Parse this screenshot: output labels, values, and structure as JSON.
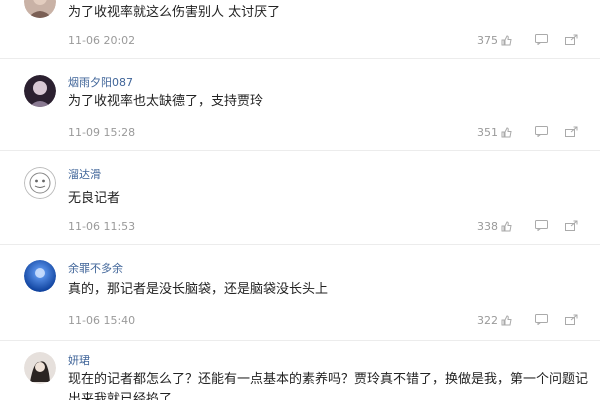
{
  "comments": [
    {
      "username": "",
      "text": "为了收视率就这么伤害别人 太讨厌了",
      "time": "11-06 20:02",
      "likes": "375"
    },
    {
      "username": "烟雨夕阳087",
      "text": "为了收视率也太缺德了，支持贾玲",
      "time": "11-09 15:28",
      "likes": "351"
    },
    {
      "username": "溜达滑",
      "text": "无良记者",
      "time": "11-06 11:53",
      "likes": "338"
    },
    {
      "username": "余罪不多余",
      "text": "真的，那记者是没长脑袋，还是脑袋没长头上",
      "time": "11-06 15:40",
      "likes": "322"
    },
    {
      "username": "妍珺",
      "text": "现在的记者都怎么了？还能有一点基本的素养吗？贾玲真不错了，换做是我，第一个问题记出来我就已经掐了",
      "time": "",
      "likes": ""
    }
  ],
  "icons": {
    "like": "thumb-up-icon",
    "reply": "reply-icon",
    "share": "share-icon"
  },
  "colors": {
    "username": "#406599",
    "meta": "#9a9a9a",
    "divider": "#ececec"
  }
}
